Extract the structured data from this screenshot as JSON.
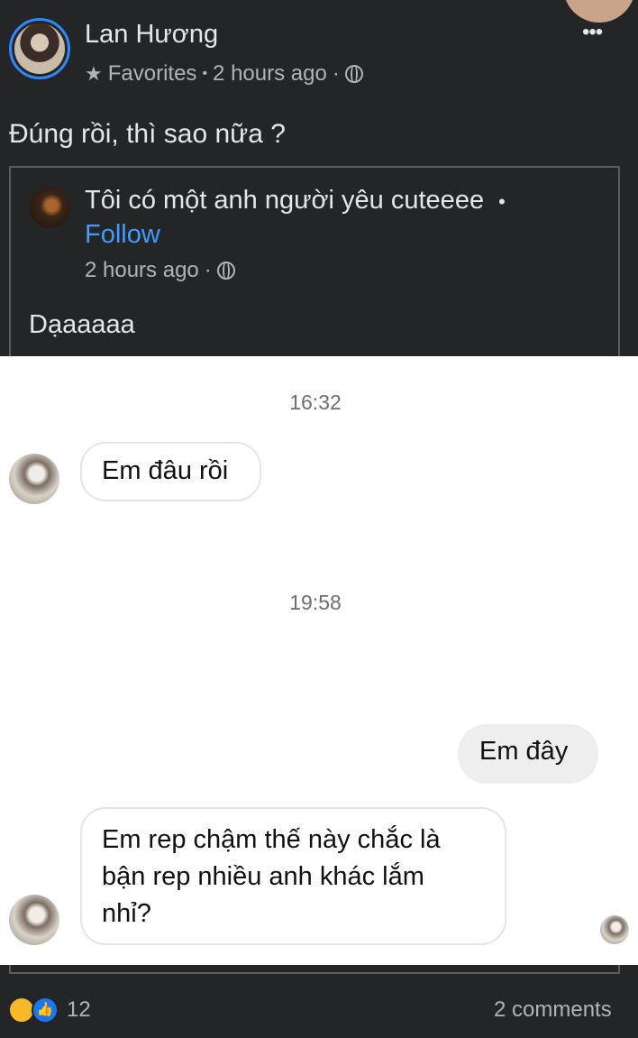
{
  "post": {
    "author": "Lan Hương",
    "audience": "Favorites",
    "time": "2 hours ago",
    "separator": "·",
    "dot_sep": "•",
    "text": "Đúng rồi, thì sao nữa ?",
    "more_icon": "•••"
  },
  "shared": {
    "page_name": "Tôi có một anh người yêu cuteeee",
    "follow": "Follow",
    "time": "2 hours ago",
    "text": "Dạaaaaa"
  },
  "chat": {
    "messages": [
      {
        "type": "time",
        "text": "16:32"
      },
      {
        "type": "incoming",
        "text": "Em đâu rồi"
      },
      {
        "type": "time",
        "text": "19:58"
      },
      {
        "type": "outgoing",
        "text": "Em đây"
      },
      {
        "type": "incoming",
        "lines": [
          "Em rep chậm thế này chắc là",
          "bận rep nhiều anh khác lắm",
          "nhỉ?"
        ]
      }
    ]
  },
  "footer": {
    "reaction_count": "12",
    "comments": "2 comments",
    "like_glyph": "👍"
  },
  "colors": {
    "accent": "#2d88ff",
    "link": "#4599ff",
    "background": "#242526"
  }
}
